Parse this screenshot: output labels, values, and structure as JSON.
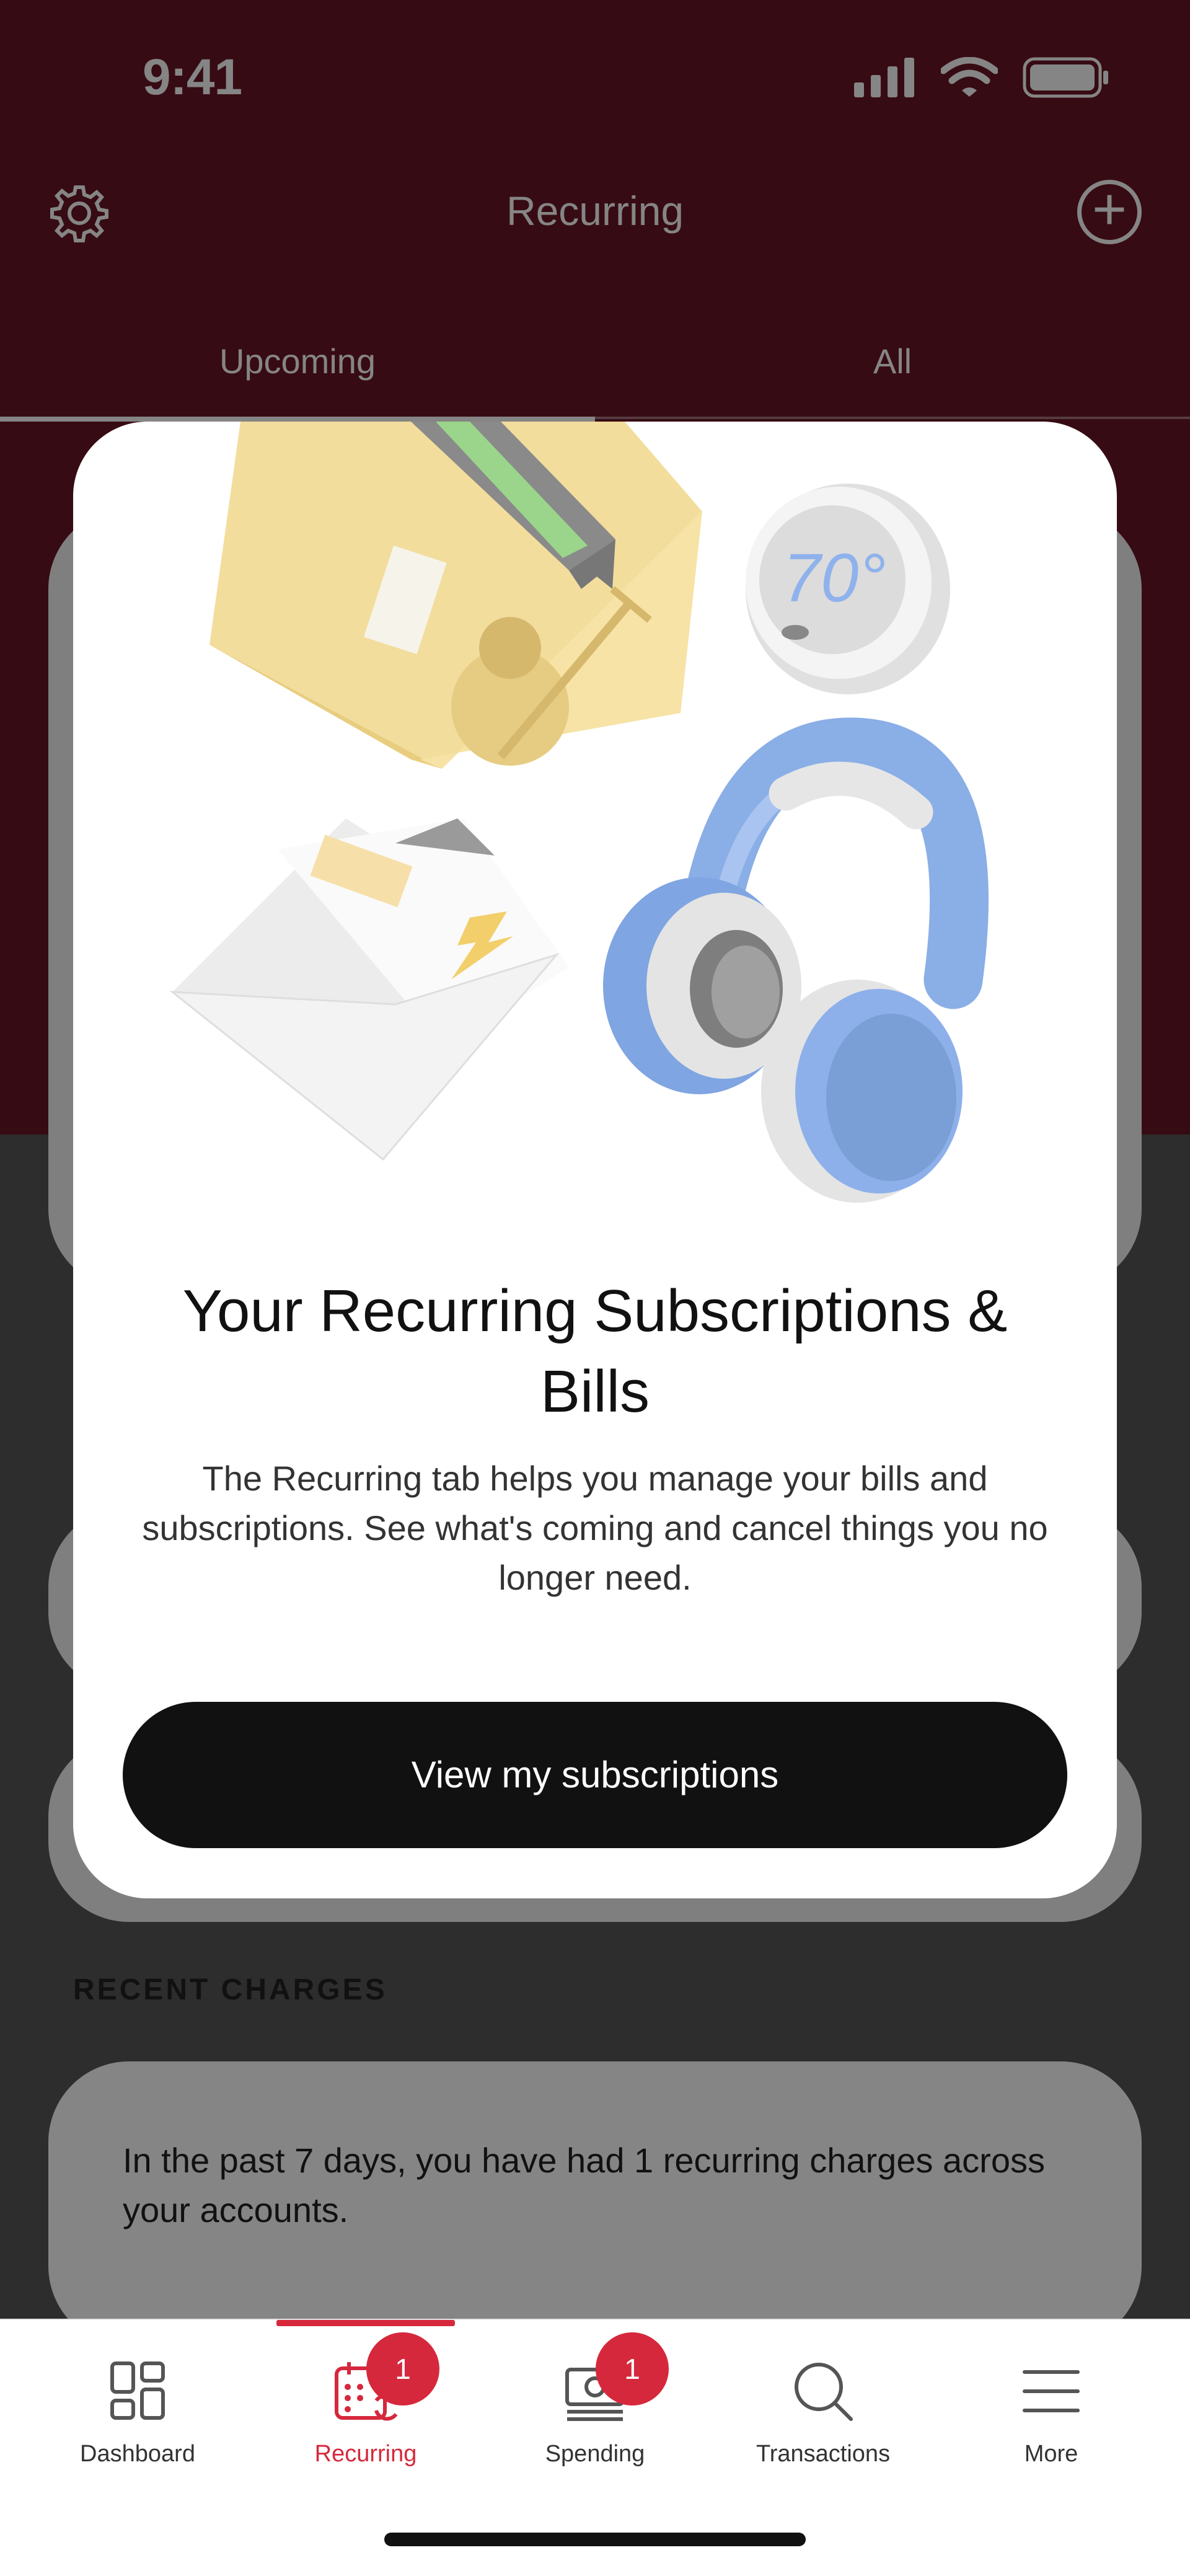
{
  "status_bar": {
    "time": "9:41",
    "icons": [
      "signal-icon",
      "wifi-icon",
      "battery-icon"
    ]
  },
  "header": {
    "title": "Recurring",
    "settings_icon": "gear-icon",
    "add_icon": "plus-circle-icon"
  },
  "tabs": [
    {
      "label": "Upcoming",
      "active": true
    },
    {
      "label": "All",
      "active": false
    }
  ],
  "recent_charges": {
    "section_label": "RECENT CHARGES",
    "summary": "In the past 7 days, you have had 1 recurring charges across your accounts."
  },
  "modal": {
    "title": "Your Recurring Subscriptions & Bills",
    "body": "The Recurring tab helps you manage your bills and subscriptions. See what's coming and cancel things you no longer need.",
    "cta_label": "View my subscriptions",
    "illustration_thermostat_text": "70°"
  },
  "bottom_nav": {
    "items": [
      {
        "label": "Dashboard",
        "icon": "dashboard-icon",
        "badge": ""
      },
      {
        "label": "Recurring",
        "icon": "recurring-calendar-icon",
        "badge": "1",
        "active": true
      },
      {
        "label": "Spending",
        "icon": "spending-money-icon",
        "badge": "1"
      },
      {
        "label": "Transactions",
        "icon": "search-icon",
        "badge": ""
      },
      {
        "label": "More",
        "icon": "menu-icon",
        "badge": ""
      }
    ]
  },
  "colors": {
    "brand_header": "#6a1626",
    "accent": "#d6283c",
    "cta_bg": "#111111"
  }
}
